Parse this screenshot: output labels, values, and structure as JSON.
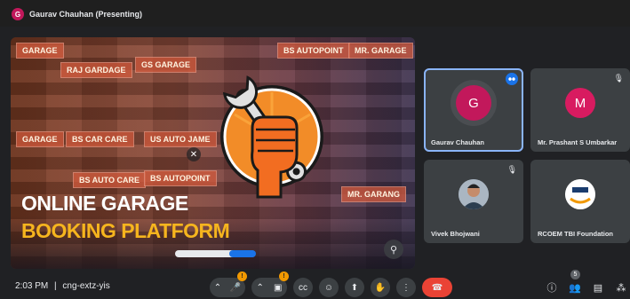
{
  "presentation": {
    "presenter_initial": "G",
    "label": "Gaurav Chauhan (Presenting)"
  },
  "slide": {
    "title_line1": "ONLINE GARAGE",
    "title_line2": "BOOKING PLATFORM",
    "shop_signs": [
      "RAJ GARDAGE",
      "BS CAR CARE",
      "GS GARAGE",
      "US AUTO JAME",
      "BS AUTOPOINT",
      "MR. GARAGE",
      "BS AUTO CARE",
      "MR. GARANG",
      "GARAGE"
    ],
    "accent_color": "#f6b51e"
  },
  "participants": [
    {
      "name": "Gaurav Chauhan",
      "initial": "G",
      "avatar_color": "#c2185b",
      "speaking": true
    },
    {
      "name": "Mr. Prashant S Umbarkar",
      "initial": "M",
      "avatar_color": "#d81b60",
      "muted": true
    },
    {
      "name": "Vivek Bhojwani",
      "initial": "",
      "avatar_type": "photo",
      "muted": true
    },
    {
      "name": "RCOEM TBI Foundation",
      "initial": "",
      "avatar_type": "logo"
    }
  ],
  "meeting": {
    "time": "2:03 PM",
    "separator": "|",
    "code": "cng-extz-yis"
  },
  "controls": {
    "mic_badge": "!",
    "camera_badge": "!",
    "people_count": "5"
  },
  "icons": {
    "mic": "microphone-icon",
    "camera": "camera-icon",
    "captions": "captions-icon",
    "emoji": "emoji-icon",
    "present": "present-icon",
    "hand": "raise-hand-icon",
    "more": "more-vert-icon",
    "end": "end-call-icon",
    "info": "info-icon",
    "people": "people-icon",
    "chat": "chat-icon",
    "activities": "activities-icon"
  },
  "colors": {
    "background": "#202124",
    "tile": "#3c4043",
    "active_outline": "#8ab4f8",
    "end_call": "#ea4335",
    "badge": "#f29900"
  }
}
